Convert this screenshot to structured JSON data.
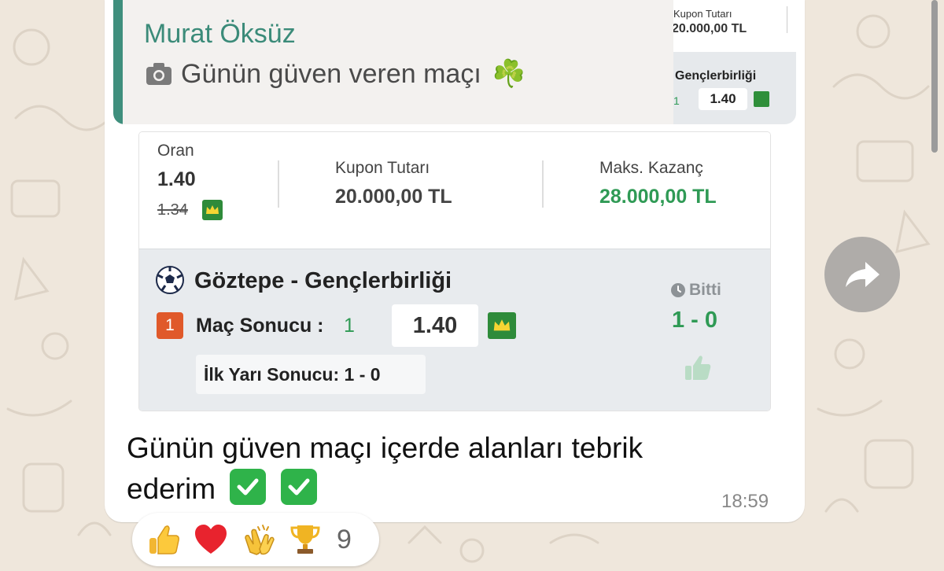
{
  "colors": {
    "accent_green": "#2f9a55",
    "quote_bar": "#3f8f7d",
    "badge_orange": "#e0592a",
    "crown_green": "#2e8b3a"
  },
  "quote": {
    "author": "Murat Öksüz",
    "text": "Günün güven veren maçı",
    "icon": "camera-icon",
    "emoji": "☘️",
    "thumb": {
      "kupon_label": "Kupon Tutarı",
      "kupon_value": "20.000,00 TL",
      "teams": "Gençlerbirliği",
      "result": "1",
      "odd": "1.40"
    }
  },
  "coupon": {
    "oran_label": "Oran",
    "oran_value": "1.40",
    "oran_old": "1.34",
    "kupon_label": "Kupon Tutarı",
    "kupon_value": "20.000,00 TL",
    "maks_label": "Maks. Kazanç",
    "maks_value": "28.000,00 TL"
  },
  "match": {
    "teams": "Göztepe - Gençlerbirliği",
    "market_number": "1",
    "market_label": "Maç Sonucu :",
    "market_pick": "1",
    "odd": "1.40",
    "half_time": "İlk Yarı Sonucu: 1 - 0",
    "status": "Bitti",
    "score": "1 - 0"
  },
  "message": {
    "text_line1": "Günün güven maçı içerde alanları tebrik",
    "text_line2": "ederim",
    "time": "18:59"
  },
  "reactions": {
    "items": [
      "thumbs-up",
      "heart",
      "clapping-hands",
      "trophy"
    ],
    "count": "9"
  }
}
